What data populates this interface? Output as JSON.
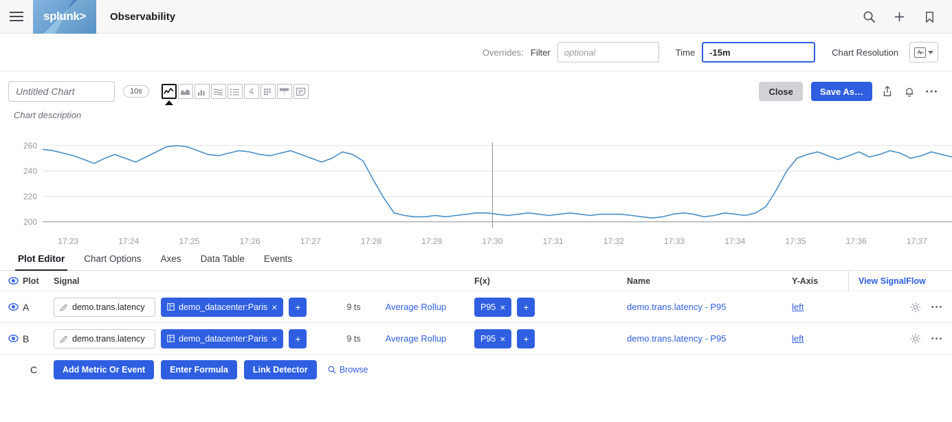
{
  "header": {
    "brand": "splunk>",
    "app_title": "Observability",
    "menu_icon": "hamburger-icon",
    "icons": [
      "search-icon",
      "plus-icon",
      "bookmark-icon"
    ]
  },
  "overrides": {
    "label": "Overrides:",
    "filter_label": "Filter",
    "filter_value": "",
    "filter_placeholder": "optional",
    "time_label": "Time",
    "time_value": "-15m",
    "resolution_label": "Chart Resolution",
    "resolution_icon": "chart-resolution-icon"
  },
  "chart_header": {
    "title_value": "",
    "title_placeholder": "Untitled Chart",
    "refresh_interval": "10s",
    "chart_types": [
      {
        "name": "line-chart-type",
        "glyph": "line",
        "selected": true
      },
      {
        "name": "area-chart-type",
        "glyph": "area",
        "selected": false
      },
      {
        "name": "column-chart-type",
        "glyph": "column",
        "selected": false
      },
      {
        "name": "histogram-chart-type",
        "glyph": "histogram",
        "selected": false
      },
      {
        "name": "list-chart-type",
        "glyph": "list",
        "selected": false
      },
      {
        "name": "single-value-chart-type",
        "glyph": "4",
        "selected": false
      },
      {
        "name": "heatmap-chart-type",
        "glyph": "heatmap",
        "selected": false
      },
      {
        "name": "event-feed-chart-type",
        "glyph": "!",
        "selected": false
      },
      {
        "name": "text-note-chart-type",
        "glyph": "note",
        "selected": false
      }
    ],
    "close_label": "Close",
    "save_label": "Save As…",
    "action_icons": [
      "share-icon",
      "bell-icon",
      "more-options-icon"
    ],
    "description_placeholder": "Chart description"
  },
  "tabs": [
    {
      "label": "Plot Editor",
      "active": true
    },
    {
      "label": "Chart Options",
      "active": false
    },
    {
      "label": "Axes",
      "active": false
    },
    {
      "label": "Data Table",
      "active": false
    },
    {
      "label": "Events",
      "active": false
    }
  ],
  "plot_table": {
    "columns": {
      "plot": "Plot",
      "signal": "Signal",
      "fx": "F(x)",
      "name": "Name",
      "yaxis": "Y-Axis",
      "signalflow": "View SignalFlow"
    },
    "rows": [
      {
        "id": "A",
        "signal": "demo.trans.latency",
        "filter_chip": "demo_datacenter:Paris",
        "timeseries_count": "9 ts",
        "rollup": "Average Rollup",
        "fx_chip": "P95",
        "name": "demo.trans.latency - P95",
        "yaxis": "left",
        "add_label": "+",
        "remove_label": "×"
      },
      {
        "id": "B",
        "signal": "demo.trans.latency",
        "filter_chip": "demo_datacenter:Paris",
        "timeseries_count": "9 ts",
        "rollup": "Average Rollup",
        "fx_chip": "P95",
        "name": "demo.trans.latency - P95",
        "yaxis": "left",
        "add_label": "+",
        "remove_label": "×"
      }
    ],
    "new_row": {
      "id": "C",
      "add_metric_label": "Add Metric Or Event",
      "formula_label": "Enter Formula",
      "detector_label": "Link Detector",
      "browse_label": "Browse"
    }
  },
  "chart_data": {
    "type": "line",
    "title": "",
    "xlabel": "",
    "ylabel": "",
    "ylim": [
      195,
      268
    ],
    "yticks": [
      200,
      220,
      240,
      260
    ],
    "grid": true,
    "legend": "none",
    "series_color": "#4a8dc4",
    "marker_line_x": "17:30",
    "xticks": [
      "17:23",
      "17:24",
      "17:25",
      "17:26",
      "17:27",
      "17:28",
      "17:29",
      "17:30",
      "17:31",
      "17:32",
      "17:33",
      "17:34",
      "17:35",
      "17:36",
      "17:37"
    ],
    "xlim": [
      "17:22:40",
      "17:37:30"
    ],
    "series": [
      {
        "name": "demo.trans.latency - P95",
        "x": [
          0,
          1,
          2,
          3,
          4,
          5,
          6,
          7,
          8,
          9,
          10,
          11,
          12,
          13,
          14,
          15,
          16,
          17,
          18,
          19,
          20,
          21,
          22,
          23,
          24,
          25,
          26,
          27,
          28,
          29,
          30,
          31,
          32,
          33,
          34,
          35,
          36,
          37,
          38,
          39,
          40,
          41,
          42,
          43,
          44,
          45,
          46,
          47,
          48,
          49,
          50,
          51,
          52,
          53,
          54,
          55,
          56,
          57,
          58,
          59,
          60,
          61,
          62,
          63,
          64,
          65,
          66,
          67,
          68,
          69,
          70,
          71,
          72,
          73,
          74,
          75,
          76,
          77,
          78,
          79,
          80,
          81,
          82,
          83,
          84,
          85,
          86,
          87,
          88
        ],
        "values": [
          257,
          256,
          254,
          252,
          249,
          246,
          250,
          253,
          250,
          247,
          251,
          255,
          259,
          260,
          259,
          256,
          253,
          252,
          254,
          256,
          255,
          253,
          252,
          254,
          256,
          253,
          250,
          247,
          250,
          255,
          253,
          248,
          233,
          219,
          207,
          205,
          204,
          204,
          205,
          204,
          205,
          206,
          207,
          207,
          206,
          205,
          206,
          207,
          206,
          205,
          206,
          207,
          206,
          205,
          206,
          206,
          206,
          205,
          204,
          203,
          204,
          206,
          207,
          206,
          204,
          205,
          207,
          206,
          205,
          207,
          212,
          225,
          240,
          250,
          253,
          255,
          252,
          249,
          252,
          255,
          251,
          253,
          256,
          254,
          250,
          252,
          255,
          253,
          251
        ]
      }
    ]
  }
}
